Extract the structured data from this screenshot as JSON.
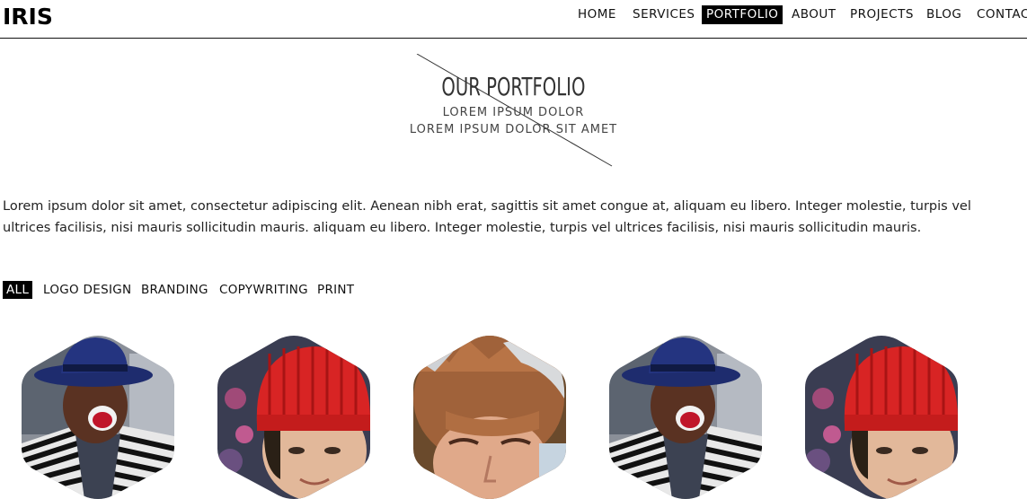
{
  "header": {
    "logo": "IRIS",
    "nav": [
      {
        "label": "HOME",
        "active": false
      },
      {
        "label": "SERVICES",
        "active": false
      },
      {
        "label": "PORTFOLIO",
        "active": true
      },
      {
        "label": "ABOUT",
        "active": false
      },
      {
        "label": "PROJECTS",
        "active": false
      },
      {
        "label": "BLOG",
        "active": false
      },
      {
        "label": "CONTACT",
        "active": false
      }
    ]
  },
  "hero": {
    "title": "OUR PORTFOLIO",
    "subtitle1": "LOREM IPSUM DOLOR",
    "subtitle2": "LOREM IPSUM DOLOR SIT AMET"
  },
  "intro": "Lorem ipsum dolor sit amet, consectetur adipiscing elit. Aenean nibh erat, sagittis sit amet congue at, aliquam eu libero. Integer molestie, turpis vel ultrices facilisis, nisi mauris sollicitudin mauris. aliquam eu libero. Integer molestie, turpis vel ultrices facilisis, nisi mauris sollicitudin mauris.",
  "filters": [
    {
      "label": "ALL",
      "active": true
    },
    {
      "label": "LOGO DESIGN",
      "active": false
    },
    {
      "label": "BRANDING",
      "active": false
    },
    {
      "label": "COPYWRITING",
      "active": false
    },
    {
      "label": "PRINT",
      "active": false
    }
  ],
  "portfolio": [
    {
      "subject": "man-blue-hat"
    },
    {
      "subject": "girl-red-beanie"
    },
    {
      "subject": "woman-lace-cap"
    },
    {
      "subject": "man-blue-hat"
    },
    {
      "subject": "girl-red-beanie"
    }
  ],
  "colors": {
    "accent": "#000000",
    "text": "#222222"
  }
}
